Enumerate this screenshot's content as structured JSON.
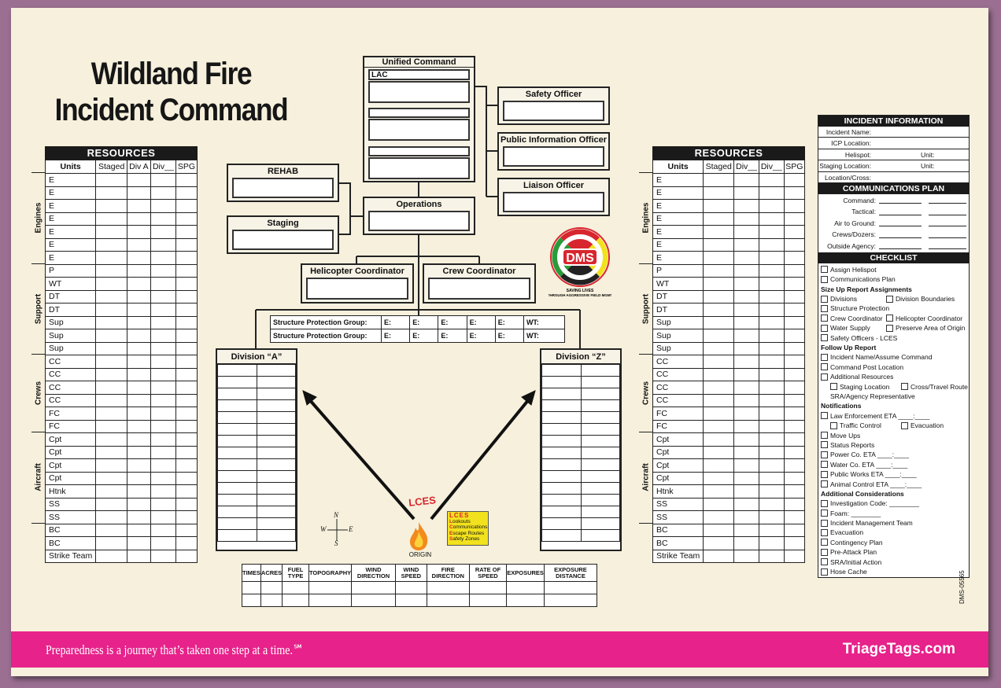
{
  "title": {
    "line1": "Wildland Fire",
    "line2": "Incident Command"
  },
  "resources_left": {
    "title": "RESOURCES",
    "columns": [
      "Units",
      "Staged",
      "Div A",
      "Div__",
      "SPG"
    ]
  },
  "resources_right": {
    "title": "RESOURCES",
    "columns": [
      "Units",
      "Staged",
      "Div__",
      "Div__",
      "SPG"
    ]
  },
  "resource_groups": [
    {
      "label": "Engines",
      "start": 0,
      "count": 7
    },
    {
      "label": "Support",
      "start": 7,
      "count": 7
    },
    {
      "label": "Crews",
      "start": 14,
      "count": 6
    },
    {
      "label": "Aircraft",
      "start": 20,
      "count": 7
    },
    {
      "label": "",
      "start": 27,
      "count": 3
    }
  ],
  "resource_units": [
    "E",
    "E",
    "E",
    "E",
    "E",
    "E",
    "E",
    "P",
    "WT",
    "DT",
    "DT",
    "Sup",
    "Sup",
    "Sup",
    "CC",
    "CC",
    "CC",
    "CC",
    "FC",
    "FC",
    "Cpt",
    "Cpt",
    "Cpt",
    "Cpt",
    "Htnk",
    "SS",
    "SS",
    "BC",
    "BC",
    "Strike Team"
  ],
  "org": {
    "unified_command": "Unified Command",
    "lac": "LAC",
    "safety": "Safety Officer",
    "pio": "Public Information Officer",
    "liaison": "Liaison Officer",
    "rehab": "REHAB",
    "staging": "Staging",
    "operations": "Operations",
    "helicopter": "Helicopter Coordinator",
    "crew": "Crew Coordinator"
  },
  "structure_protection": {
    "label": "Structure Protection Group:",
    "cells": [
      "E:",
      "E:",
      "E:",
      "E:",
      "E:",
      "WT:"
    ],
    "rows": 2
  },
  "divisions": {
    "a": "Division “A”",
    "z": "Division “Z”"
  },
  "origin": {
    "lces_arc": "LCES",
    "label": "ORIGIN"
  },
  "lces_box": {
    "title": "LCES",
    "items": [
      "Lookouts",
      "Communications",
      "Escape Routes",
      "Safety Zones"
    ]
  },
  "compass": {
    "n": "N",
    "s": "S",
    "e": "E",
    "w": "W"
  },
  "bottom_table": {
    "headers": [
      "TIMES",
      "ACRES",
      "FUEL TYPE",
      "TOPOGRAPHY",
      "WIND DIRECTION",
      "WIND SPEED",
      "FIRE DIRECTION",
      "RATE OF SPEED",
      "EXPOSURES",
      "EXPOSURE DISTANCE"
    ]
  },
  "incident_info": {
    "title": "INCIDENT INFORMATION",
    "fields": [
      {
        "k": "Incident Name:"
      },
      {
        "k": "ICP Location:"
      },
      {
        "k": "Helispot:",
        "u": "Unit:"
      },
      {
        "k": "Staging Location:",
        "u": "Unit:"
      },
      {
        "k": "Location/Cross:"
      }
    ]
  },
  "comm_plan": {
    "title": "COMMUNICATIONS PLAN",
    "fields": [
      "Command:",
      "Tactical:",
      "Air to Ground:",
      "Crews/Dozers:",
      "Outside Agency:"
    ]
  },
  "checklist": {
    "title": "CHECKLIST",
    "items": [
      {
        "t": "c",
        "a": "Assign Helispot"
      },
      {
        "t": "c",
        "a": "Communications Plan"
      },
      {
        "t": "h",
        "a": "Size Up Report Assignments"
      },
      {
        "t": "c",
        "a": "Divisions",
        "b": "Division Boundaries"
      },
      {
        "t": "c",
        "a": "Structure Protection"
      },
      {
        "t": "c",
        "a": "Crew Coordinator",
        "b": "Helicopter Coordinator"
      },
      {
        "t": "c",
        "a": "Water Supply",
        "b": "Preserve Area of Origin"
      },
      {
        "t": "c",
        "a": "Safety Officers - LCES"
      },
      {
        "t": "h",
        "a": "Follow Up Report"
      },
      {
        "t": "c",
        "a": "Incident Name/Assume Command"
      },
      {
        "t": "c",
        "a": "Command Post Location"
      },
      {
        "t": "c",
        "a": "Additional Resources"
      },
      {
        "t": "i",
        "a": "Staging Location",
        "b": "Cross/Travel Route"
      },
      {
        "t": "p",
        "a": "SRA/Agency Representative"
      },
      {
        "t": "h",
        "a": "Notifications"
      },
      {
        "t": "c",
        "a": "Law Enforcement ETA ____:____"
      },
      {
        "t": "i",
        "a": "Traffic Control",
        "b": "Evacuation"
      },
      {
        "t": "c",
        "a": "Move Ups"
      },
      {
        "t": "c",
        "a": "Status Reports"
      },
      {
        "t": "c",
        "a": "Power Co. ETA ____:____"
      },
      {
        "t": "c",
        "a": "Water Co. ETA ____:____"
      },
      {
        "t": "c",
        "a": "Public Works ETA ____:____"
      },
      {
        "t": "c",
        "a": "Animal Control ETA ____:____"
      },
      {
        "t": "h",
        "a": "Additional Considerations"
      },
      {
        "t": "c",
        "a": "Investigation Code: ________"
      },
      {
        "t": "c",
        "a": "Foam: ________"
      },
      {
        "t": "c",
        "a": "Incident Management Team"
      },
      {
        "t": "c",
        "a": "Evacuation"
      },
      {
        "t": "c",
        "a": "Contingency Plan"
      },
      {
        "t": "c",
        "a": "Pre-Attack Plan"
      },
      {
        "t": "c",
        "a": "SRA/Initial Action"
      },
      {
        "t": "c",
        "a": "Hose Cache"
      }
    ]
  },
  "logo": {
    "text": "DMS",
    "ring": "DISASTER MANAGEMENT SYSTEMS, INC.",
    "tagline": "SAVING LIVES THROUGH AGGRESSIVE FIELD MANAGEMENT™"
  },
  "product_code": "DMS-05565",
  "footer": {
    "tagline": "Preparedness is a journey that’s taken one step at a time.℠",
    "site": "TriageTags.com"
  },
  "colors": {
    "background": "#9a6f91",
    "board": "#f6f0dc",
    "footer": "#e7228a",
    "lces_yellow": "#f2e21e",
    "lces_red": "#d8262e"
  }
}
